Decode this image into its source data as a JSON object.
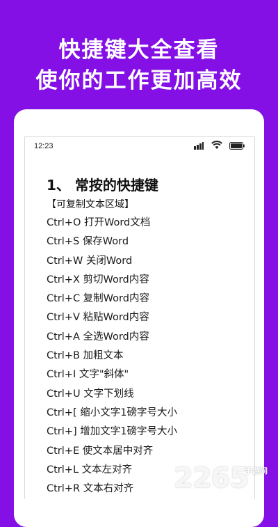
{
  "banner": {
    "line1": "快捷键大全查看",
    "line2": "使你的工作更加高效"
  },
  "statusbar": {
    "time": "12:23",
    "icons": [
      "signal-icon",
      "wifi-icon",
      "battery-icon"
    ]
  },
  "content": {
    "title": "1、 常按的快捷键",
    "section_label": "【可复制文本区域】",
    "shortcuts": [
      "Ctrl+O 打开Word文档",
      "Ctrl+S 保存Word",
      "Ctrl+W 关闭Word",
      "Ctrl+X 剪切Word内容",
      "Ctrl+C 复制Word内容",
      "Ctrl+V 粘贴Word内容",
      "Ctrl+A 全选Word内容",
      "Ctrl+B 加粗文本",
      "Ctrl+I 文字\"斜体\"",
      "Ctrl+U 文字下划线",
      "Ctrl+[ 缩小文字1磅字号大小",
      "Ctrl+] 增加文字1磅字号大小",
      "Ctrl+E 使文本居中对齐",
      "Ctrl+L 文本左对齐",
      "Ctrl+R 文本右对齐"
    ]
  },
  "watermark": {
    "number": "2265",
    "sub": "手游网"
  },
  "colors": {
    "background": "#8410e6",
    "banner_text": "#ffffff",
    "body_text": "#1a1a1a"
  }
}
